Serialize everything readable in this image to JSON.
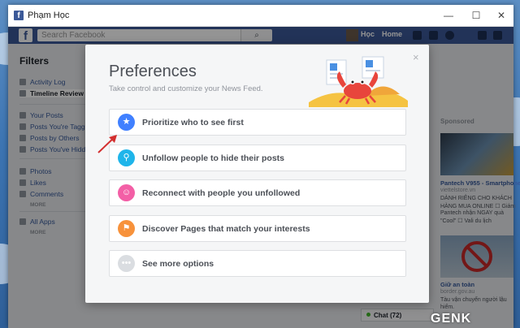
{
  "window": {
    "title": "Phạm Học",
    "app_icon": "facebook-icon",
    "minimize": "—",
    "maximize": "☐",
    "close": "✕"
  },
  "fb_header": {
    "logo": "f",
    "search_placeholder": "Search Facebook",
    "search_button": "⌕",
    "user_name": "Học",
    "home": "Home"
  },
  "left_nav": {
    "title": "Filters",
    "items": [
      {
        "label": "Activity Log"
      },
      {
        "label": "Timeline Review"
      },
      {
        "label": "Your Posts"
      },
      {
        "label": "Posts You're Tagged In"
      },
      {
        "label": "Posts by Others"
      },
      {
        "label": "Posts You've Hidden"
      },
      {
        "label": "Photos"
      },
      {
        "label": "Likes"
      },
      {
        "label": "Comments"
      },
      {
        "label": "All Apps"
      }
    ],
    "more_label": "MORE"
  },
  "sidebar": {
    "sponsored": "Sponsored",
    "ad1": {
      "title": "Pantech V955 - Smartphone",
      "domain": "viettelstore.vn",
      "lines": [
        "DÀNH RIÊNG CHO KHÁCH",
        "HÀNG MUA ONLINE ☐ Giảm",
        "Pantech nhận NGAY quà",
        "\"Cool\" ☐ Vali du lịch"
      ]
    },
    "ad2": {
      "title": "Giữ an toàn",
      "domain": "border.gov.au",
      "lines": [
        "Tàu vận chuyển người lậu",
        "hiểm."
      ]
    },
    "chat": "Chat (72)"
  },
  "dialog": {
    "close": "×",
    "title": "Preferences",
    "subtitle": "Take control and customize your News Feed.",
    "options": [
      {
        "label": "Prioritize who to see first",
        "icon": "star-icon",
        "color": "#4080ff"
      },
      {
        "label": "Unfollow people to hide their posts",
        "icon": "search-icon",
        "color": "#1fb5ea"
      },
      {
        "label": "Reconnect with people you unfollowed",
        "icon": "smile-icon",
        "color": "#f35fa6"
      },
      {
        "label": "Discover Pages that match your interests",
        "icon": "flag-icon",
        "color": "#f7923b"
      },
      {
        "label": "See more options",
        "icon": "more-icon",
        "color": "#dadde1"
      }
    ]
  },
  "watermark": "GENK"
}
